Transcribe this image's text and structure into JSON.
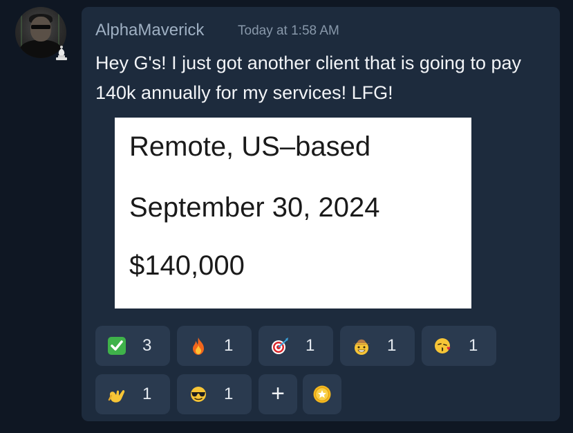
{
  "message": {
    "username": "AlphaMaverick",
    "timestamp": "Today at 1:58 AM",
    "text": "Hey G's! I just got another client that is going to pay 140k annually for my services! LFG!",
    "attachment": {
      "lines": [
        "Remote, US–based",
        "September 30, 2024",
        "$140,000"
      ]
    }
  },
  "reactions": [
    {
      "icon": "check-mark-icon",
      "count": "3"
    },
    {
      "icon": "fire-icon",
      "count": "1"
    },
    {
      "icon": "dart-target-icon",
      "count": "1"
    },
    {
      "icon": "cowboy-face-icon",
      "count": "1"
    },
    {
      "icon": "kissing-face-icon",
      "count": "1"
    },
    {
      "icon": "call-me-hand-icon",
      "count": "1"
    },
    {
      "icon": "sunglasses-face-icon",
      "count": "1"
    }
  ],
  "add_reaction_label": "+",
  "colors": {
    "background": "#0f1723",
    "card": "#1d2b3d",
    "reaction_bg": "#2a3a4f",
    "username": "#9fb0c3",
    "text": "#f2f4f7"
  }
}
